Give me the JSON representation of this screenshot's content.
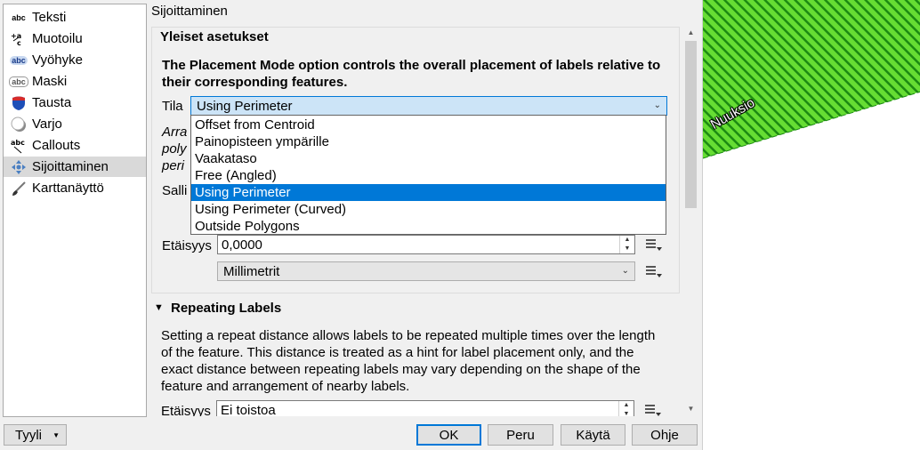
{
  "sidebar": {
    "items": [
      {
        "label": "Teksti",
        "icon": "abc-text-icon"
      },
      {
        "label": "Muotoilu",
        "icon": "formatting-icon"
      },
      {
        "label": "Vyöhyke",
        "icon": "buffer-icon"
      },
      {
        "label": "Maski",
        "icon": "mask-icon"
      },
      {
        "label": "Tausta",
        "icon": "background-shield-icon"
      },
      {
        "label": "Varjo",
        "icon": "shadow-icon"
      },
      {
        "label": "Callouts",
        "icon": "callouts-icon"
      },
      {
        "label": "Sijoittaminen",
        "icon": "placement-icon",
        "selected": true
      },
      {
        "label": "Karttanäyttö",
        "icon": "rendering-brush-icon"
      }
    ],
    "icon_text": "abc"
  },
  "section_title": "Sijoittaminen",
  "general": {
    "title": "Yleiset asetukset",
    "description": "The Placement Mode option controls the overall placement of labels relative to their corresponding features.",
    "mode_label": "Tila",
    "mode_value": "Using Perimeter",
    "hidden_desc_lines": [
      "Arra",
      "poly",
      "peri"
    ],
    "allowed_label": "Salli",
    "distance_label": "Etäisyys",
    "distance_value": "0,0000",
    "unit_value": "Millimetrit"
  },
  "mode_options": [
    "Offset from Centroid",
    "Painopisteen ympärille",
    "Vaakataso",
    "Free (Angled)",
    "Using Perimeter",
    "Using Perimeter (Curved)",
    "Outside Polygons"
  ],
  "selected_mode_index": 4,
  "repeating": {
    "title": "Repeating Labels",
    "description": "Setting a repeat distance allows labels to be repeated multiple times over the length of the feature. This distance is treated as a hint for label placement only, and the exact distance between repeating labels may vary depending on the shape of the feature and arrangement of nearby labels.",
    "distance_label": "Etäisyys",
    "distance_value": "Ei toistoa"
  },
  "bottom": {
    "style_label": "Tyyli",
    "ok": "OK",
    "cancel": "Peru",
    "apply": "Käytä",
    "help": "Ohje"
  },
  "map": {
    "label": "Nuuksio",
    "fill_color": "#66dd33",
    "stripe_color": "#1c8a12"
  }
}
